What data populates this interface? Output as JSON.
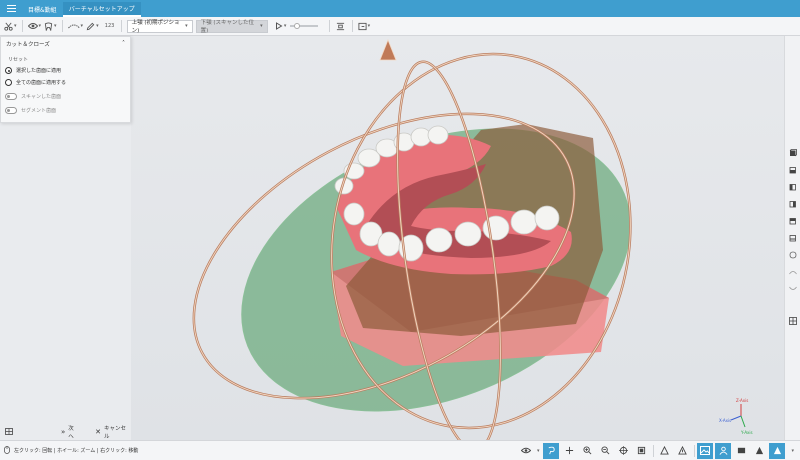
{
  "titlebar": {
    "tabs": [
      {
        "label": "目標&勤組",
        "active": false
      },
      {
        "label": "バーチャルセットアップ",
        "active": true
      }
    ]
  },
  "toolbar": {
    "counter": "123",
    "upper_combo": "上顎 (初期ポジション)",
    "lower_combo": "下顎 (スキャンした位置)"
  },
  "left_panel": {
    "title": "カット＆クローズ",
    "reset_label": "リセット",
    "radio_options": [
      {
        "label": "選択した歯面に適用",
        "checked": true
      },
      {
        "label": "全ての歯面に適用する",
        "checked": false
      }
    ],
    "toggles": [
      {
        "label": "スキャンした歯面"
      },
      {
        "label": "セグメント歯面"
      }
    ]
  },
  "bottom_left": {
    "next_label": "次へ",
    "cancel_label": "キャンセル"
  },
  "status": {
    "hint": "左クリック: 回転 | ホイール: ズーム | 右クリック: 移動"
  },
  "axes": {
    "z": "Z-Axis",
    "x": "X-Axis",
    "y": "Y-Axis"
  },
  "colors": {
    "accent": "#3f9ecf",
    "plane": "#6aa97c",
    "gingiva": "#e8737a",
    "base": "#f08b8b",
    "ring": "#e8c3a8"
  }
}
